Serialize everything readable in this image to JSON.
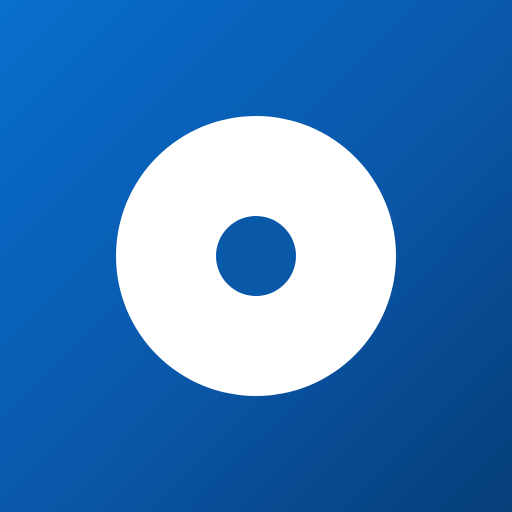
{
  "app_icon": {
    "icon": "ring-icon",
    "background_start": "#0870cc",
    "background_end": "#063f7a",
    "foreground": "#ffffff"
  }
}
